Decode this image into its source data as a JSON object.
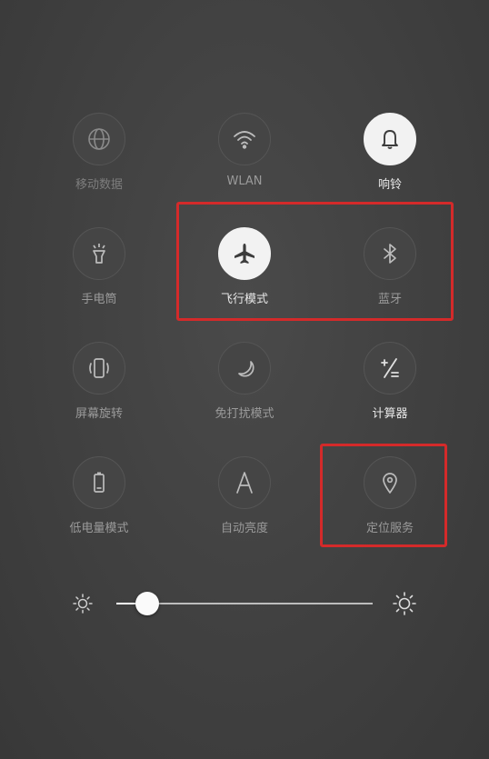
{
  "tiles": [
    {
      "label": "移动数据",
      "icon": "globe-icon",
      "active": false
    },
    {
      "label": "WLAN",
      "icon": "wifi-icon",
      "active": false
    },
    {
      "label": "响铃",
      "icon": "bell-icon",
      "active": true
    },
    {
      "label": "手电筒",
      "icon": "flashlight-icon",
      "active": false
    },
    {
      "label": "飞行模式",
      "icon": "airplane-icon",
      "active": true
    },
    {
      "label": "蓝牙",
      "icon": "bluetooth-icon",
      "active": false
    },
    {
      "label": "屏幕旋转",
      "icon": "screen-rotate-icon",
      "active": false
    },
    {
      "label": "免打扰模式",
      "icon": "moon-icon",
      "active": false
    },
    {
      "label": "计算器",
      "icon": "calculator-icon",
      "active": false
    },
    {
      "label": "低电量模式",
      "icon": "battery-icon",
      "active": false
    },
    {
      "label": "自动亮度",
      "icon": "auto-brightness-icon",
      "active": false
    },
    {
      "label": "定位服务",
      "icon": "location-pin-icon",
      "active": false
    }
  ],
  "brightness": {
    "level": 0.12
  },
  "colors": {
    "highlight": "#d42a2a",
    "active_tile": "#f2f2f2"
  }
}
